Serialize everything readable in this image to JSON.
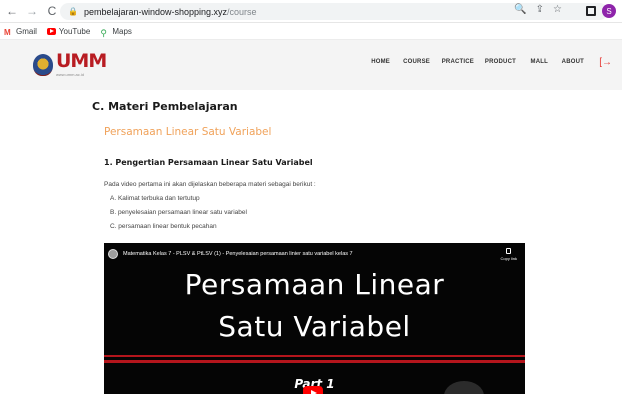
{
  "browser": {
    "url_host": "pembelajaran-window-shopping.xyz",
    "url_path": "/course",
    "profile_initial": "S",
    "bookmarks": [
      {
        "label": "Gmail",
        "icon": "gmail-icon"
      },
      {
        "label": "YouTube",
        "icon": "youtube-icon"
      },
      {
        "label": "Maps",
        "icon": "maps-icon"
      }
    ]
  },
  "site": {
    "logo_text": "UMM",
    "logo_url": "www.umm.ac.id",
    "menu": [
      "HOME",
      "COURSE",
      "PRACTICE",
      "PRODUCT",
      "MALL",
      "ABOUT"
    ]
  },
  "content": {
    "section_title": "C. Materi Pembelajaran",
    "subtitle": "Persamaan Linear Satu Variabel",
    "heading": "1. Pengertian Persamaan Linear Satu Variabel",
    "paragraph": "Pada video pertama ini akan dijelaskan beberapa materi sebagai berikut :",
    "list": [
      "A. Kalimat terbuka dan tertutup",
      "B. penyelesaian persamaan linear satu variabel",
      "C. persamaan linear bentuk pecahan"
    ]
  },
  "video": {
    "title": "Matematika Kelas 7 - PLSV & PtLSV (1) - Penyelesaian persamaan linier satu variabel kelas 7",
    "copy_label": "Copy link",
    "line1": "Persamaan Linear",
    "line2": "Satu Variabel",
    "part": "Part 1"
  },
  "colors": {
    "brand_red": "#b81c22",
    "subtitle_orange": "#f0a25a",
    "logout_red": "#e53935",
    "video_stripe": "#b4151c"
  }
}
